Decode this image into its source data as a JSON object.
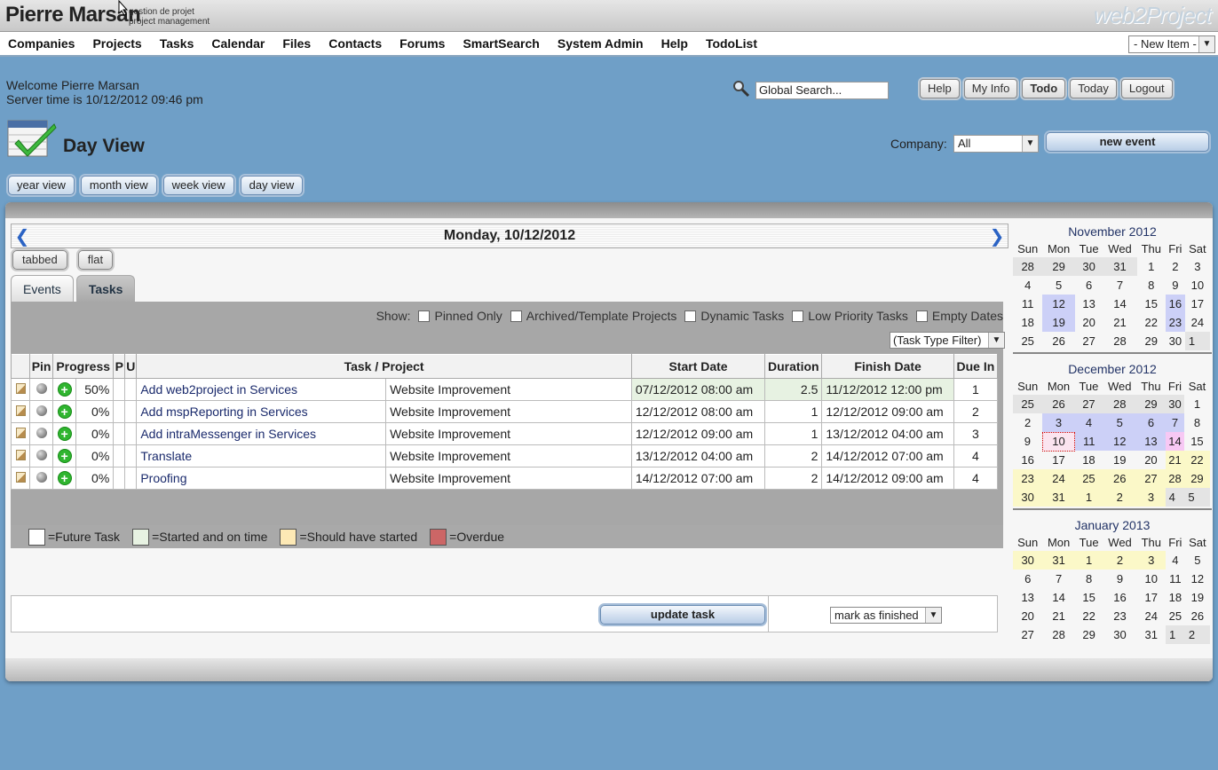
{
  "brand": {
    "name": "Pierre Marsan",
    "sub1": "gestion de projet",
    "sub2": "project management",
    "logo": "web2Project"
  },
  "menu": [
    "Companies",
    "Projects",
    "Tasks",
    "Calendar",
    "Files",
    "Contacts",
    "Forums",
    "SmartSearch",
    "System Admin",
    "Help",
    "TodoList"
  ],
  "new_item": "- New Item -",
  "welcome": {
    "line1": "Welcome Pierre Marsan",
    "line2": "Server time is 10/12/2012 09:46 pm"
  },
  "search": {
    "placeholder": "Global Search..."
  },
  "top_buttons": [
    "Help",
    "My Info",
    "Todo",
    "Today",
    "Logout"
  ],
  "page": {
    "title": "Day View",
    "company_label": "Company:",
    "company_value": "All",
    "new_event": "new event"
  },
  "view_buttons": [
    "year view",
    "month view",
    "week view",
    "day view"
  ],
  "date_title": "Monday, 10/12/2012",
  "mode_buttons": [
    "tabbed",
    "flat"
  ],
  "tabs": [
    "Events",
    "Tasks"
  ],
  "show": {
    "label": "Show:",
    "options": [
      "Pinned Only",
      "Archived/Template Projects",
      "Dynamic Tasks",
      "Low Priority Tasks",
      "Empty Dates"
    ]
  },
  "task_type_filter": "(Task Type Filter)",
  "columns": [
    "Pin",
    "Progress",
    "P",
    "U",
    "Task / Project",
    "Start Date",
    "Duration",
    "Finish Date",
    "Due In"
  ],
  "tasks": [
    {
      "progress": "50%",
      "task": "Add web2project in Services",
      "project": "Website Improvement",
      "start": "07/12/2012 08:00 am",
      "duration": "2.5",
      "finish": "11/12/2012 12:00 pm",
      "due": "1",
      "status": "started"
    },
    {
      "progress": "0%",
      "task": "Add mspReporting in Services",
      "project": "Website Improvement",
      "start": "12/12/2012 08:00 am",
      "duration": "1",
      "finish": "12/12/2012 09:00 am",
      "due": "2",
      "status": "future"
    },
    {
      "progress": "0%",
      "task": "Add intraMessenger in Services",
      "project": "Website Improvement",
      "start": "12/12/2012 09:00 am",
      "duration": "1",
      "finish": "13/12/2012 04:00 am",
      "due": "3",
      "status": "future"
    },
    {
      "progress": "0%",
      "task": "Translate",
      "project": "Website Improvement",
      "start": "13/12/2012 04:00 am",
      "duration": "2",
      "finish": "14/12/2012 07:00 am",
      "due": "4",
      "status": "future"
    },
    {
      "progress": "0%",
      "task": "Proofing",
      "project": "Website Improvement",
      "start": "14/12/2012 07:00 am",
      "duration": "2",
      "finish": "14/12/2012 09:00 am",
      "due": "4",
      "status": "future"
    }
  ],
  "update_task": "update task",
  "mark_finished": "mark as finished",
  "legend": [
    "=Future Task",
    "=Started and on time",
    "=Should have started",
    "=Overdue"
  ],
  "legend_colors": [
    "#ffffff",
    "#e7f2e2",
    "#fde9b5",
    "#cc6666"
  ],
  "weekdays": [
    "Sun",
    "Mon",
    "Tue",
    "Wed",
    "Thu",
    "Fri",
    "Sat"
  ],
  "calendars": [
    {
      "title": "November 2012",
      "weeks": [
        [
          "28",
          "29",
          "30",
          "31",
          "1",
          "2",
          "3"
        ],
        [
          "4",
          "5",
          "6",
          "7",
          "8",
          "9",
          "10"
        ],
        [
          "11",
          "12",
          "13",
          "14",
          "15",
          "16",
          "17"
        ],
        [
          "18",
          "19",
          "20",
          "21",
          "22",
          "23",
          "24"
        ],
        [
          "25",
          "26",
          "27",
          "28",
          "29",
          "30",
          "1"
        ]
      ],
      "other": [
        [
          0,
          0
        ],
        [
          0,
          1
        ],
        [
          0,
          2
        ],
        [
          0,
          3
        ],
        [
          4,
          6
        ]
      ],
      "hl": [
        [
          2,
          1
        ],
        [
          2,
          5
        ],
        [
          3,
          1
        ],
        [
          3,
          5
        ]
      ]
    },
    {
      "title": "December 2012",
      "weeks": [
        [
          "25",
          "26",
          "27",
          "28",
          "29",
          "30",
          "1"
        ],
        [
          "2",
          "3",
          "4",
          "5",
          "6",
          "7",
          "8"
        ],
        [
          "9",
          "10",
          "11",
          "12",
          "13",
          "14",
          "15"
        ],
        [
          "16",
          "17",
          "18",
          "19",
          "20",
          "21",
          "22"
        ],
        [
          "23",
          "24",
          "25",
          "26",
          "27",
          "28",
          "29"
        ],
        [
          "30",
          "31",
          "1",
          "2",
          "3",
          "4",
          "5"
        ]
      ],
      "other": [
        [
          0,
          0
        ],
        [
          0,
          1
        ],
        [
          0,
          2
        ],
        [
          0,
          3
        ],
        [
          0,
          4
        ],
        [
          0,
          5
        ],
        [
          5,
          5
        ],
        [
          5,
          6
        ]
      ],
      "hl": [
        [
          1,
          1
        ],
        [
          1,
          2
        ],
        [
          1,
          3
        ],
        [
          1,
          4
        ],
        [
          1,
          5
        ],
        [
          2,
          2
        ],
        [
          2,
          3
        ],
        [
          2,
          4
        ]
      ],
      "today": [
        [
          2,
          1
        ]
      ],
      "pink": [
        [
          2,
          5
        ]
      ],
      "y": [
        [
          3,
          5
        ],
        [
          3,
          6
        ],
        [
          4,
          0
        ],
        [
          4,
          1
        ],
        [
          4,
          2
        ],
        [
          4,
          3
        ],
        [
          4,
          4
        ],
        [
          4,
          5
        ],
        [
          4,
          6
        ],
        [
          5,
          0
        ],
        [
          5,
          1
        ],
        [
          5,
          2
        ],
        [
          5,
          3
        ],
        [
          5,
          4
        ]
      ]
    },
    {
      "title": "January 2013",
      "weeks": [
        [
          "30",
          "31",
          "1",
          "2",
          "3",
          "4",
          "5"
        ],
        [
          "6",
          "7",
          "8",
          "9",
          "10",
          "11",
          "12"
        ],
        [
          "13",
          "14",
          "15",
          "16",
          "17",
          "18",
          "19"
        ],
        [
          "20",
          "21",
          "22",
          "23",
          "24",
          "25",
          "26"
        ],
        [
          "27",
          "28",
          "29",
          "30",
          "31",
          "1",
          "2"
        ]
      ],
      "other": [
        [
          4,
          5
        ],
        [
          4,
          6
        ]
      ],
      "y": [
        [
          0,
          0
        ],
        [
          0,
          1
        ],
        [
          0,
          2
        ],
        [
          0,
          3
        ],
        [
          0,
          4
        ]
      ]
    }
  ]
}
